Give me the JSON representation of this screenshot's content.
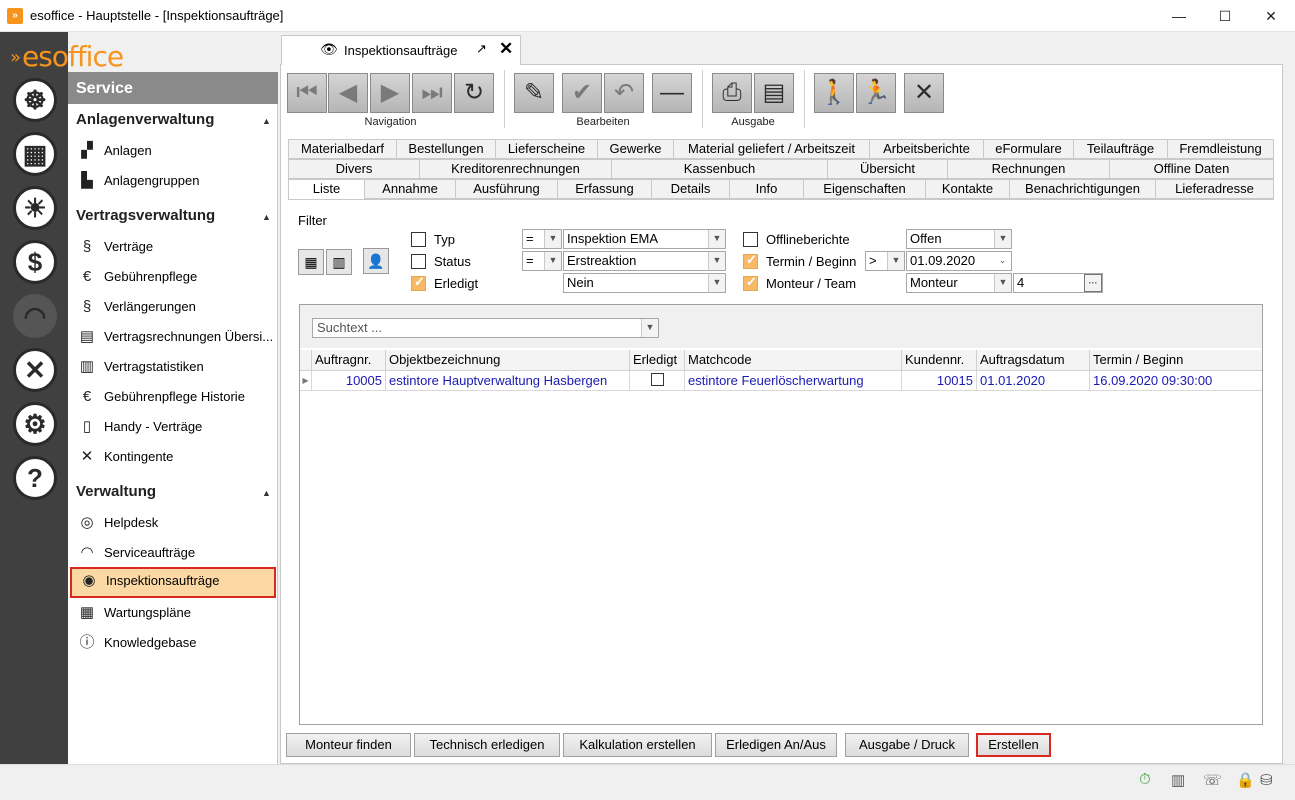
{
  "window": {
    "title": "esoffice - Hauptstelle - [Inspektionsaufträge]",
    "minimize": "—",
    "maximize": "☐",
    "close": "✕"
  },
  "logo": "esoffice",
  "sidebar": {
    "header": "Service",
    "groups": [
      {
        "label": "Anlagenverwaltung",
        "items": [
          "Anlagen",
          "Anlagengruppen"
        ]
      },
      {
        "label": "Vertragsverwaltung",
        "items": [
          "Verträge",
          "Gebührenpflege",
          "Verlängerungen",
          "Vertragsrechnungen Übersi...",
          "Vertragstatistiken",
          "Gebührenpflege Historie",
          "Handy - Verträge",
          "Kontingente"
        ]
      },
      {
        "label": "Verwaltung",
        "items": [
          "Helpdesk",
          "Serviceaufträge",
          "Inspektionsaufträge",
          "Wartungspläne",
          "Knowledgebase"
        ]
      }
    ],
    "active_item": "Inspektionsaufträge"
  },
  "tab": {
    "label": "Inspektionsaufträge"
  },
  "toolbar": {
    "groups": [
      "Navigation",
      "Bearbeiten",
      "Ausgabe"
    ],
    "icons": [
      "first-record-icon",
      "previous-record-icon",
      "next-record-icon",
      "last-record-icon",
      "refresh-icon",
      "edit-icon",
      "confirm-icon",
      "undo-icon",
      "delete-icon",
      "print-icon",
      "report-icon",
      "walk-icon",
      "run-icon",
      "close-icon"
    ]
  },
  "tabs": {
    "row1": [
      "Materialbedarf",
      "Bestellungen",
      "Lieferscheine",
      "Gewerke",
      "Material geliefert / Arbeitszeit",
      "Arbeitsberichte",
      "eFormulare",
      "Teilaufträge",
      "Fremdleistung"
    ],
    "row2": [
      "Divers",
      "Kreditorenrechnungen",
      "Kassenbuch",
      "Übersicht",
      "Rechnungen",
      "Offline Daten"
    ],
    "row3": [
      "Liste",
      "Annahme",
      "Ausführung",
      "Erfassung",
      "Details",
      "Info",
      "Eigenschaften",
      "Kontakte",
      "Benachrichtigungen",
      "Lieferadresse"
    ],
    "active": "Liste"
  },
  "filter": {
    "title": "Filter",
    "typ": {
      "label": "Typ",
      "checked": false,
      "operator": "=",
      "value": "Inspektion EMA"
    },
    "status": {
      "label": "Status",
      "checked": false,
      "operator": "=",
      "value": "Erstreaktion"
    },
    "erledigt": {
      "label": "Erledigt",
      "checked": true,
      "value": "Nein"
    },
    "offlineberichte": {
      "label": "Offlineberichte",
      "checked": false,
      "value": "Offen"
    },
    "termin": {
      "label": "Termin / Beginn",
      "checked": true,
      "operator": ">",
      "value": "01.09.2020"
    },
    "monteur": {
      "label": "Monteur / Team",
      "checked": true,
      "value": "Monteur",
      "number": "4",
      "ellipsis": "···"
    }
  },
  "search": {
    "placeholder": "Suchtext ..."
  },
  "grid": {
    "columns": [
      "Auftragnr.",
      "Objektbezeichnung",
      "Erledigt",
      "Matchcode",
      "Kundennr.",
      "Auftragsdatum",
      "Termin / Beginn"
    ],
    "rows": [
      {
        "auftragnr": "10005",
        "objekt": "estintore Hauptverwaltung Hasbergen",
        "erledigt": false,
        "matchcode": "estintore Feuerlöscherwartung",
        "kundennr": "10015",
        "auftragsdatum": "01.01.2020",
        "termin": "16.09.2020 09:30:00"
      }
    ]
  },
  "buttons": [
    "Monteur finden",
    "Technisch erledigen",
    "Kalkulation erstellen",
    "Erledigen An/Aus",
    "Ausgabe / Druck",
    "Erstellen"
  ],
  "colors": {
    "accent": "#f7941d",
    "highlight_border": "#d9281e",
    "active_item_bg": "#fcd9a4",
    "link_blue": "#1a1ab5"
  }
}
